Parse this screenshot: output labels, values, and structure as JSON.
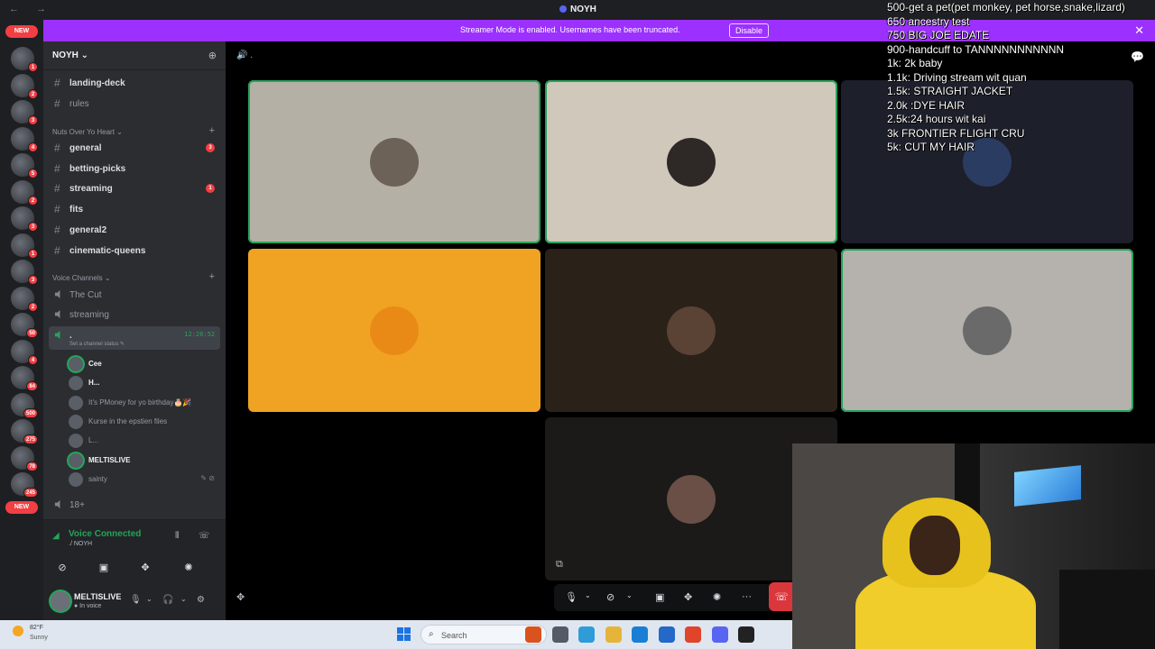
{
  "window": {
    "title": "NOYH",
    "nav": "← →"
  },
  "banner": {
    "message": "Streamer Mode is enabled. Usernames have been truncated.",
    "disable_label": "Disable",
    "close": "✕",
    "color": "#9b30ff"
  },
  "rail": {
    "new_label": "NEW",
    "badges": [
      "1",
      "2",
      "3",
      "4",
      "5",
      "2",
      "3",
      "1",
      "3",
      "2",
      "50",
      "4",
      "84",
      "500",
      "275",
      "78",
      "245"
    ]
  },
  "server": {
    "name": "NOYH ⌄",
    "invite_icon": "add-user-icon"
  },
  "channels_top": [
    {
      "label": "landing-deck",
      "bold": true,
      "badge": ""
    },
    {
      "label": "rules",
      "bold": false,
      "badge": ""
    }
  ],
  "category_nuts": "Nuts Over Yo Heart ⌄",
  "channels_nuts": [
    {
      "label": "general",
      "badge": "3"
    },
    {
      "label": "betting-picks",
      "badge": ""
    },
    {
      "label": "streaming",
      "badge": "1"
    },
    {
      "label": "fits",
      "badge": ""
    },
    {
      "label": "general2",
      "badge": ""
    },
    {
      "label": "cinematic-queens",
      "badge": ""
    }
  ],
  "category_voice": "Voice Channels ⌄",
  "voice_channels": [
    {
      "label": "The Cut"
    },
    {
      "label": "streaming"
    }
  ],
  "active_voice": {
    "label": ".",
    "time": "12:28:52",
    "status_prompt": "Set a channel status ✎"
  },
  "members": [
    {
      "name": "Cee",
      "bright": true,
      "ring": true
    },
    {
      "name": "H...",
      "bright": true,
      "ring": false
    },
    {
      "name": "It's PMoney for yo birthday🎂🎉",
      "bright": false,
      "ring": false
    },
    {
      "name": "Kurse in the epstien files",
      "bright": false,
      "ring": false
    },
    {
      "name": "L...",
      "bright": false,
      "ring": false
    },
    {
      "name": "MELTISLIVE",
      "bright": true,
      "ring": true
    },
    {
      "name": "sainty",
      "bright": false,
      "ring": false,
      "status": "✎ ⊘"
    }
  ],
  "next_channel": "18+",
  "voice_connected": {
    "title": "Voice Connected",
    "sub": "./ NOYH"
  },
  "user": {
    "name": "MELTISLIVE",
    "status": "● In voice"
  },
  "stage": {
    "channel": "."
  },
  "tiles": [
    {
      "bg": "#b5b0a6",
      "speaking": true,
      "face": "#6d6257"
    },
    {
      "bg": "#cfc8bb",
      "speaking": true,
      "face": "#2e2926"
    },
    {
      "bg": "#1d1f2a",
      "speaking": false,
      "face": "#2b3c63"
    },
    {
      "bg": "#f0a323",
      "speaking": false,
      "face": "#e98a16"
    },
    {
      "bg": "#2a2118",
      "speaking": false,
      "face": "#5a4234"
    },
    {
      "bg": "#b5b1ac",
      "speaking": true,
      "face": "#6a6a6a"
    },
    {
      "bg": "#1c1a18",
      "speaking": false,
      "face": "#6a4f46"
    }
  ],
  "goals": [
    "500-get a pet(pet monkey, pet horse,snake,lizard)",
    "650 ancestry test",
    "750 BIG JOE EDATE",
    "900-handcuff to TANNNNNNNNNNN",
    "1k: 2k baby",
    "1.1k: Driving stream wit quan",
    "1.5k: STRAIGHT JACKET",
    "2.0k :DYE HAIR",
    "2.5k:24 hours wit kai",
    "3k FRONTIER FLIGHT CRU",
    "5k: CUT MY HAIR"
  ],
  "taskbar": {
    "temp": "82°F",
    "cond": "Sunny",
    "search": "Search",
    "apps": [
      "#d9531e",
      "#555b66",
      "#2f9cd8",
      "#e7b43a",
      "#1a7fd4",
      "#2468c8",
      "#e0442a",
      "#5865f2",
      "#222222"
    ]
  }
}
